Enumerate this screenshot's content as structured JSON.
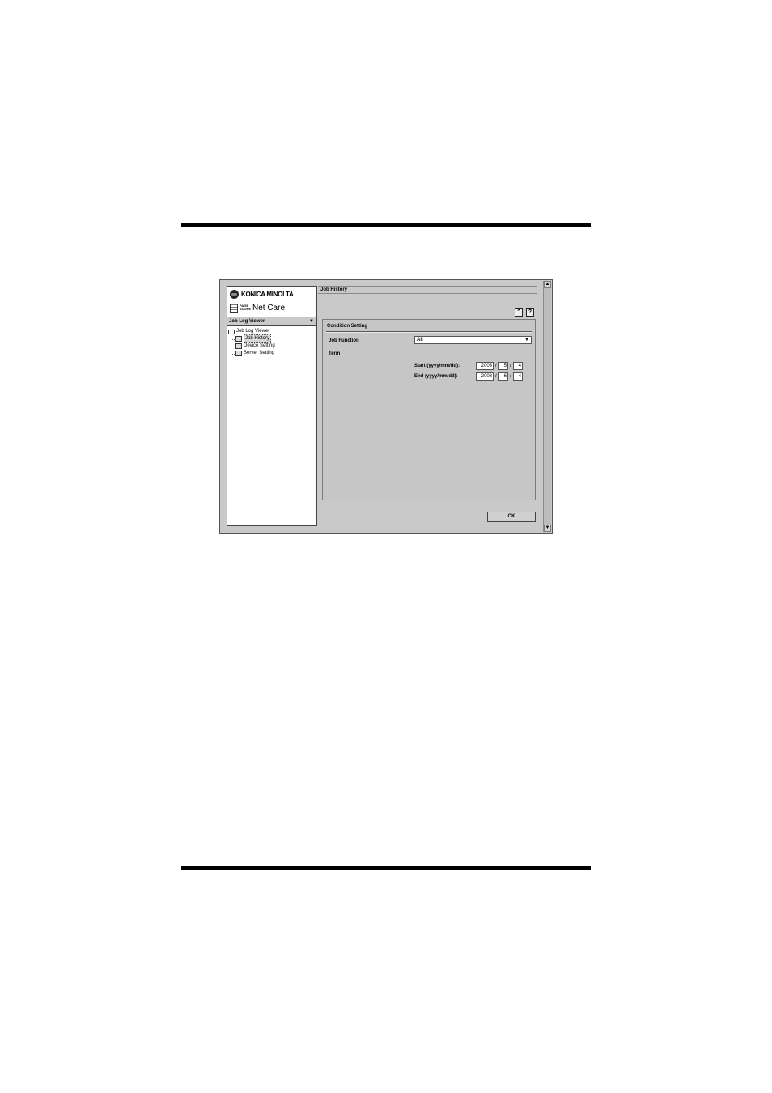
{
  "sidebar": {
    "brand": "KONICA MINOLTA",
    "product_small": "PAGE SCOPE",
    "product_name": "Net Care",
    "viewer_select": "Job Log Viewer",
    "tree": {
      "root": "Job Log Viewer",
      "items": [
        "Job History",
        "Device Setting",
        "Server Setting"
      ],
      "selected": "Job History"
    }
  },
  "main": {
    "title": "Job History",
    "top_icon": "⌃",
    "help_icon": "?",
    "section_title": "Condition Setting",
    "job_function_label": "Job Function",
    "job_function_value": "All",
    "term_label": "Term",
    "start_label": "Start (yyyy/mm/dd):",
    "end_label": "End (yyyy/mm/dd):",
    "start": {
      "year": "2003",
      "month": "5",
      "day": "4"
    },
    "end": {
      "year": "2003",
      "month": "6",
      "day": "4"
    },
    "date_separator": "/",
    "ok_label": "OK"
  }
}
